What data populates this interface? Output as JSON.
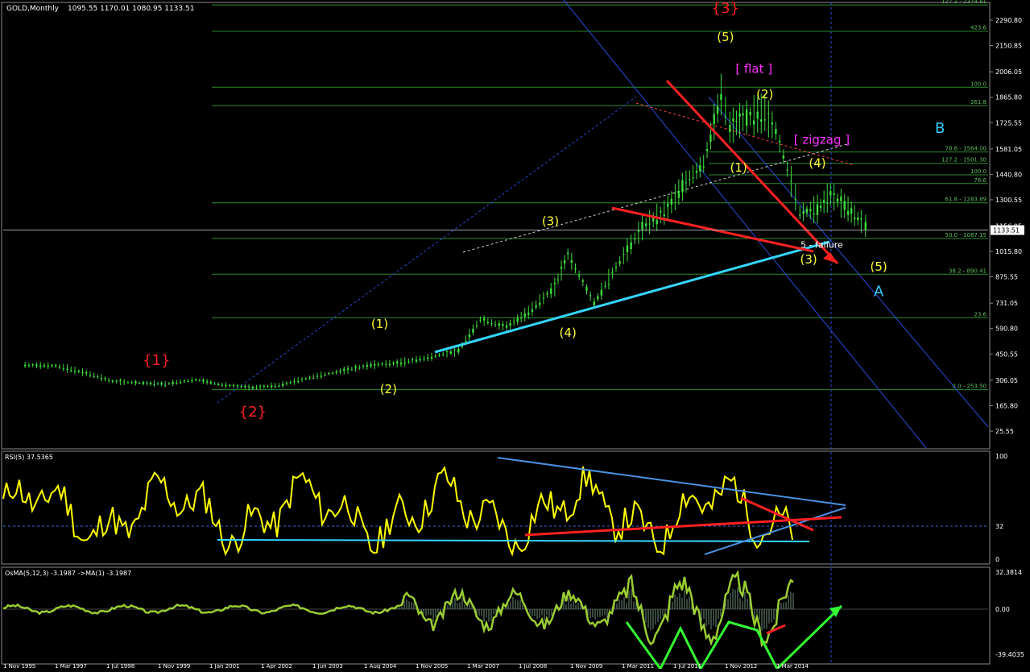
{
  "chart_data": {
    "type": "candlestick",
    "title": "GOLD,Monthly",
    "ohlc": "1095.55 1170.01 1080.95 1133.51",
    "last_price": "1133.51",
    "colors": {
      "background": "#000000",
      "candle": "#3ddc3d",
      "fib": "#2e8b2e",
      "label": "#ffffff",
      "wave_red": "#ff2020",
      "wave_yellow": "#ffff33",
      "wave_cyan": "#33ccff",
      "channel": "#2a4bd8",
      "magenta": "#ff33ff",
      "trend_red": "#ff2020",
      "trend_cyan": "#33d6ff",
      "rsi_line": "#ffff00",
      "osma_line": "#9acd32",
      "arrow_green": "#33ff33"
    },
    "price_axis": {
      "ticks": [
        "2290.80",
        "2150.85",
        "2006.05",
        "1865.80",
        "1725.55",
        "1581.05",
        "1440.80",
        "1300.55",
        "1156.05",
        "1015.80",
        "875.55",
        "731.05",
        "590.80",
        "450.55",
        "306.05",
        "165.80",
        "25.55"
      ]
    },
    "date_axis": [
      "1 Nov 1995",
      "1 Mar 1997",
      "1 Jul 1998",
      "1 Nov 1999",
      "1 Jan 2001",
      "1 Apr 2002",
      "1 Jun 2003",
      "1 Aug 2004",
      "1 Nov 2005",
      "1 Mar 2007",
      "1 Jul 2008",
      "1 Nov 2009",
      "1 Mar 2011",
      "1 Jul 2011",
      "1 Nov 2012",
      "1 Mar 2014"
    ],
    "series": [
      {
        "x": 1995.8,
        "y": 390
      },
      {
        "x": 1996.5,
        "y": 385
      },
      {
        "x": 1997.2,
        "y": 345
      },
      {
        "x": 1997.8,
        "y": 300
      },
      {
        "x": 1998.5,
        "y": 290
      },
      {
        "x": 1999.0,
        "y": 285
      },
      {
        "x": 1999.7,
        "y": 310
      },
      {
        "x": 2000.3,
        "y": 280
      },
      {
        "x": 2001.0,
        "y": 265
      },
      {
        "x": 2001.6,
        "y": 278
      },
      {
        "x": 2002.3,
        "y": 320
      },
      {
        "x": 2003.0,
        "y": 355
      },
      {
        "x": 2003.7,
        "y": 390
      },
      {
        "x": 2004.3,
        "y": 400
      },
      {
        "x": 2005.0,
        "y": 430
      },
      {
        "x": 2005.7,
        "y": 470
      },
      {
        "x": 2006.2,
        "y": 640
      },
      {
        "x": 2006.8,
        "y": 600
      },
      {
        "x": 2007.3,
        "y": 680
      },
      {
        "x": 2007.9,
        "y": 820
      },
      {
        "x": 2008.2,
        "y": 1000
      },
      {
        "x": 2008.8,
        "y": 730
      },
      {
        "x": 2009.3,
        "y": 930
      },
      {
        "x": 2009.9,
        "y": 1150
      },
      {
        "x": 2010.4,
        "y": 1230
      },
      {
        "x": 2010.9,
        "y": 1400
      },
      {
        "x": 2011.3,
        "y": 1500
      },
      {
        "x": 2011.7,
        "y": 1880
      },
      {
        "x": 2011.9,
        "y": 1700
      },
      {
        "x": 2012.2,
        "y": 1750
      },
      {
        "x": 2012.7,
        "y": 1780
      },
      {
        "x": 2012.95,
        "y": 1680
      },
      {
        "x": 2013.3,
        "y": 1400
      },
      {
        "x": 2013.5,
        "y": 1230
      },
      {
        "x": 2013.9,
        "y": 1250
      },
      {
        "x": 2014.2,
        "y": 1330
      },
      {
        "x": 2014.6,
        "y": 1250
      },
      {
        "x": 2014.9,
        "y": 1180
      },
      {
        "x": 2015.1,
        "y": 1133
      }
    ],
    "fib_levels": [
      {
        "label": "127.2 - 2374.81",
        "y": 2374.81
      },
      {
        "label": "423.6",
        "y": 2230
      },
      {
        "label": "100.0",
        "y": 1921
      },
      {
        "label": "261.8",
        "y": 1820
      },
      {
        "label": "78.6 - 1564.00",
        "y": 1564
      },
      {
        "label": "127.2 - 1501.30",
        "y": 1501.3
      },
      {
        "label": "100.0",
        "y": 1438
      },
      {
        "label": "76.6",
        "y": 1390
      },
      {
        "label": "61.8 - 1283.89",
        "y": 1283.89
      },
      {
        "label": "50.0 - 1087.15",
        "y": 1087.15
      },
      {
        "label": "38.2 - 890.41",
        "y": 890.41
      },
      {
        "label": "23.6",
        "y": 650
      },
      {
        "label": "0.0 - 253.50",
        "y": 253.5
      }
    ],
    "wave_labels": [
      {
        "text": "{1}",
        "x": 1998.8,
        "y": 390,
        "color": "red"
      },
      {
        "text": "{2}",
        "x": 2001.0,
        "y": 105,
        "color": "red"
      },
      {
        "text": "{3}",
        "x": 2011.8,
        "y": 2330,
        "color": "red"
      },
      {
        "text": "(1)",
        "x": 2003.9,
        "y": 595,
        "color": "yellow"
      },
      {
        "text": "(2)",
        "x": 2004.1,
        "y": 235,
        "color": "yellow"
      },
      {
        "text": "(3)",
        "x": 2007.8,
        "y": 1160,
        "color": "yellow"
      },
      {
        "text": "(4)",
        "x": 2008.2,
        "y": 545,
        "color": "yellow"
      },
      {
        "text": "(5)",
        "x": 2011.8,
        "y": 2175,
        "color": "yellow"
      },
      {
        "text": "(1)",
        "x": 2012.1,
        "y": 1455,
        "color": "yellow"
      },
      {
        "text": "(2)",
        "x": 2012.7,
        "y": 1860,
        "color": "yellow"
      },
      {
        "text": "(3)",
        "x": 2013.7,
        "y": 950,
        "color": "yellow"
      },
      {
        "text": "(4)",
        "x": 2013.9,
        "y": 1480,
        "color": "yellow"
      },
      {
        "text": "(5)",
        "x": 2015.3,
        "y": 910,
        "color": "yellow"
      },
      {
        "text": "[ flat ]",
        "x": 2012.45,
        "y": 2000,
        "color": "magenta"
      },
      {
        "text": "[ zigzag ]",
        "x": 2014.0,
        "y": 1610,
        "color": "magenta"
      },
      {
        "text": "B",
        "x": 2016.7,
        "y": 1670,
        "color": "cyan"
      },
      {
        "text": "A",
        "x": 2015.3,
        "y": 770,
        "color": "cyan"
      },
      {
        "text": "5 - failure",
        "x": 2014.0,
        "y": 1035,
        "color": "white"
      }
    ],
    "rsi": {
      "label": "RSI(5) 37.5365",
      "levels": [
        "100",
        "32",
        "0"
      ]
    },
    "osma": {
      "label": "OsMA(5,12,3) -3.1987   ->MA(1) -3.1987",
      "levels": [
        "32.3814",
        "0.00",
        "-39.4035"
      ]
    }
  }
}
